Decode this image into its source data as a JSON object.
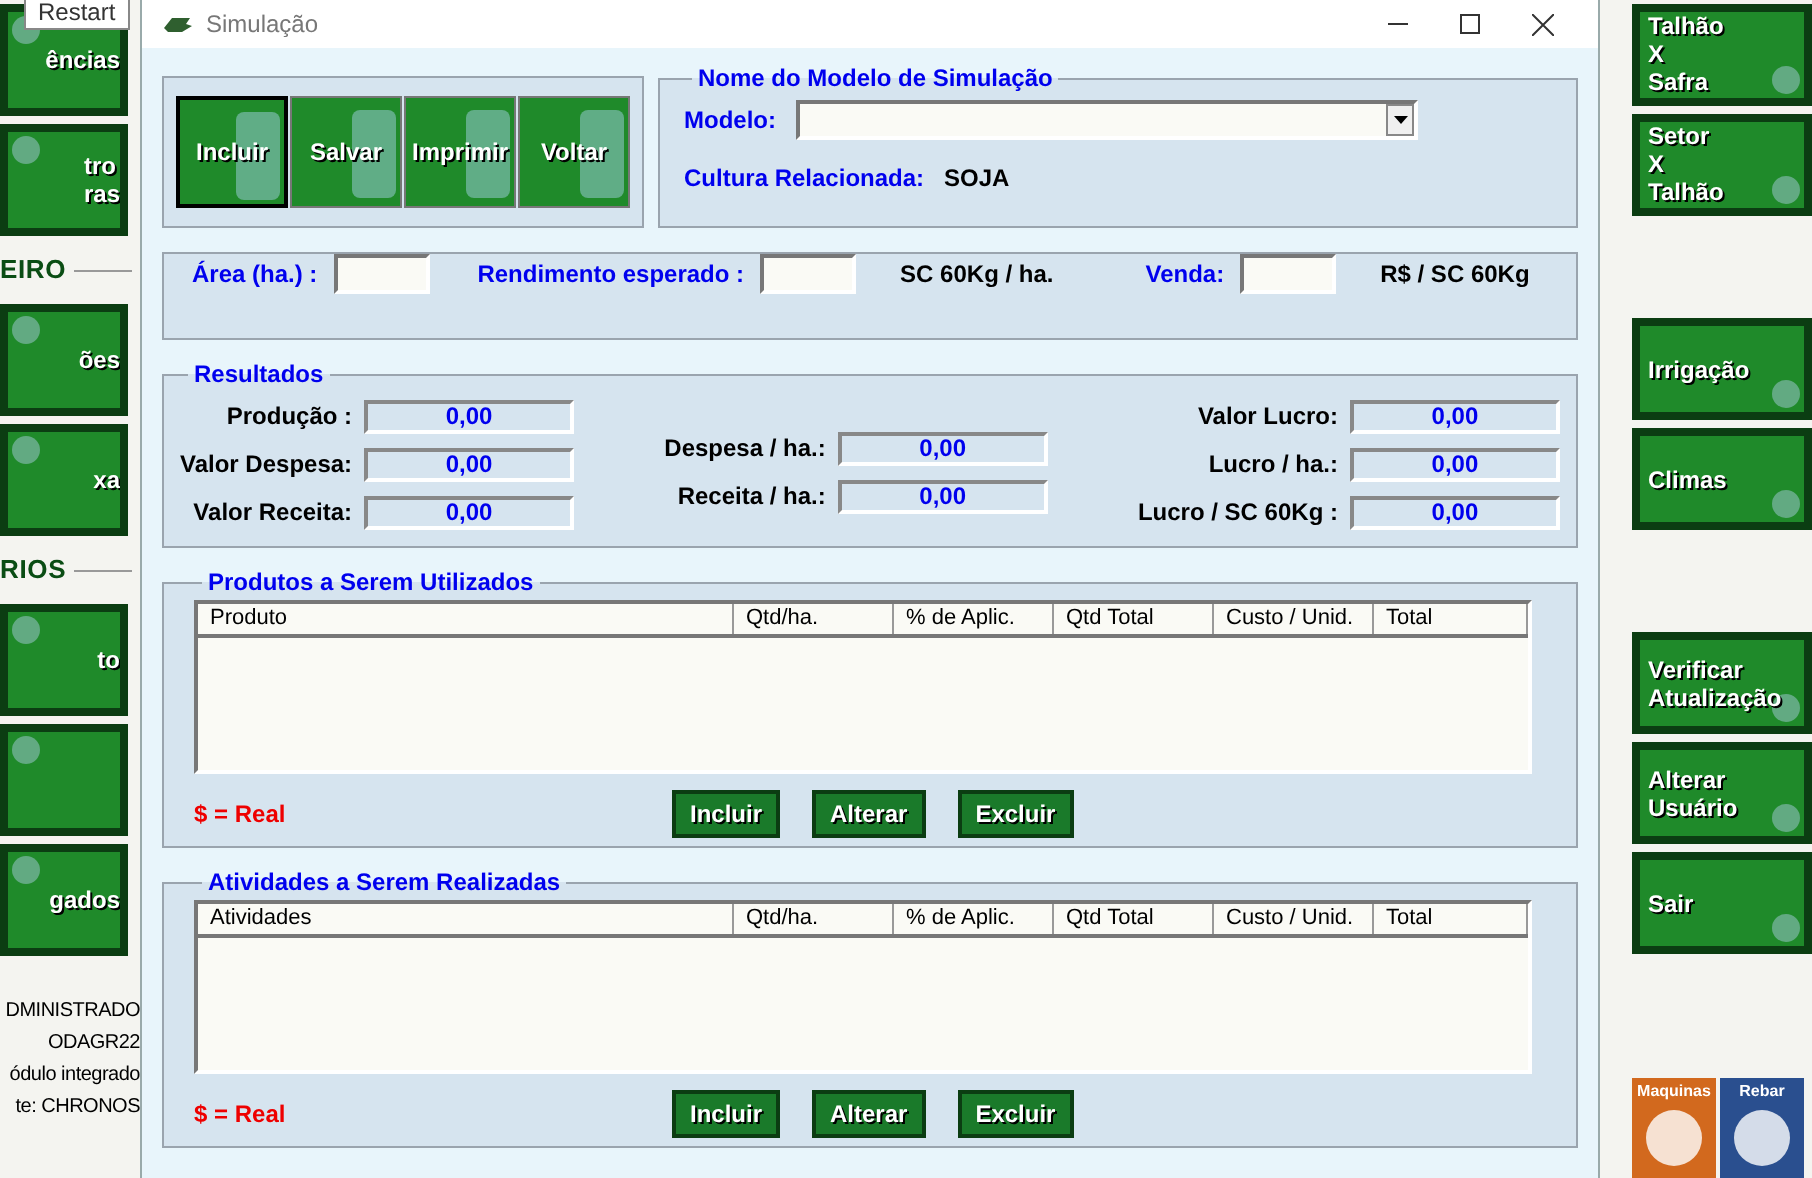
{
  "tooltip": {
    "text": "Restart"
  },
  "left_column": [
    {
      "kind": "tile",
      "lines": [
        "ências"
      ]
    },
    {
      "kind": "tile",
      "lines": [
        "tro",
        "ras"
      ]
    },
    {
      "kind": "section",
      "lines": [
        "EIRO"
      ]
    },
    {
      "kind": "tile",
      "lines": [
        "ões"
      ]
    },
    {
      "kind": "tile",
      "lines": [
        "xa"
      ]
    },
    {
      "kind": "section",
      "lines": [
        "RIOS"
      ]
    },
    {
      "kind": "tile",
      "lines": [
        "to"
      ]
    },
    {
      "kind": "tile"
    },
    {
      "kind": "tile",
      "lines": [
        "gados"
      ]
    }
  ],
  "left_info": [
    "DMINISTRADO",
    "ODAGR22",
    "ódulo integrado",
    "te: CHRONOS"
  ],
  "right_column": [
    {
      "kind": "tile",
      "lines": [
        "Talhão",
        "X",
        "Safra"
      ]
    },
    {
      "kind": "tile",
      "lines": [
        "Setor",
        "X",
        "Talhão"
      ]
    },
    {
      "kind": "gap"
    },
    {
      "kind": "tile",
      "lines": [
        "Irrigação"
      ]
    },
    {
      "kind": "tile",
      "lines": [
        "Climas"
      ]
    },
    {
      "kind": "gap"
    },
    {
      "kind": "tile",
      "lines": [
        "Verificar",
        "Atualização"
      ]
    },
    {
      "kind": "tile",
      "lines": [
        "Alterar",
        "Usuário"
      ]
    },
    {
      "kind": "tile",
      "lines": [
        "Sair"
      ]
    }
  ],
  "modules": [
    {
      "label": "Maquinas",
      "color": "#d2691e"
    },
    {
      "label": "Rebar",
      "color": "#2a4f8f"
    }
  ],
  "window": {
    "title": "Simulação"
  },
  "toolbar": [
    {
      "label": "Incluir",
      "selected": true
    },
    {
      "label": "Salvar",
      "selected": false
    },
    {
      "label": "Imprimir",
      "selected": false
    },
    {
      "label": "Voltar",
      "selected": false
    }
  ],
  "model_group": {
    "title": "Nome do Modelo de Simulação",
    "model_label": "Modelo:",
    "culture_label": "Cultura Relacionada:",
    "culture_value": "SOJA"
  },
  "inputs": [
    {
      "label": "Área (ha.) :"
    },
    {
      "label": "Rendimento esperado :",
      "unit": "SC 60Kg / ha."
    },
    {
      "label": "Venda:",
      "unit": "R$ / SC 60Kg"
    }
  ],
  "results": {
    "title": "Resultados",
    "columns": [
      [
        {
          "label": "Produção :",
          "value": "0,00"
        },
        {
          "label": "Valor Despesa:",
          "value": "0,00"
        },
        {
          "label": "Valor Receita:",
          "value": "0,00"
        }
      ],
      [
        {
          "label": "Despesa / ha.:",
          "value": "0,00"
        },
        {
          "label": "Receita / ha.:",
          "value": "0,00"
        }
      ],
      [
        {
          "label": "Valor Lucro:",
          "value": "0,00"
        },
        {
          "label": "Lucro / ha.:",
          "value": "0,00"
        },
        {
          "label": "Lucro / SC 60Kg :",
          "value": "0,00"
        }
      ]
    ]
  },
  "grids": [
    {
      "title": "Produtos a Serem Utilizados",
      "columns": [
        "Produto",
        "Qtd/ha.",
        "% de Aplic.",
        "Qtd Total",
        "Custo / Unid.",
        "Total"
      ],
      "note": "$ = Real",
      "buttons": [
        "Incluir",
        "Alterar",
        "Excluir"
      ]
    },
    {
      "title": "Atividades a Serem Realizadas",
      "columns": [
        "Atividades",
        "Qtd/ha.",
        "% de Aplic.",
        "Qtd Total",
        "Custo / Unid.",
        "Total"
      ],
      "note": "$ = Real",
      "buttons": [
        "Incluir",
        "Alterar",
        "Excluir"
      ]
    }
  ]
}
